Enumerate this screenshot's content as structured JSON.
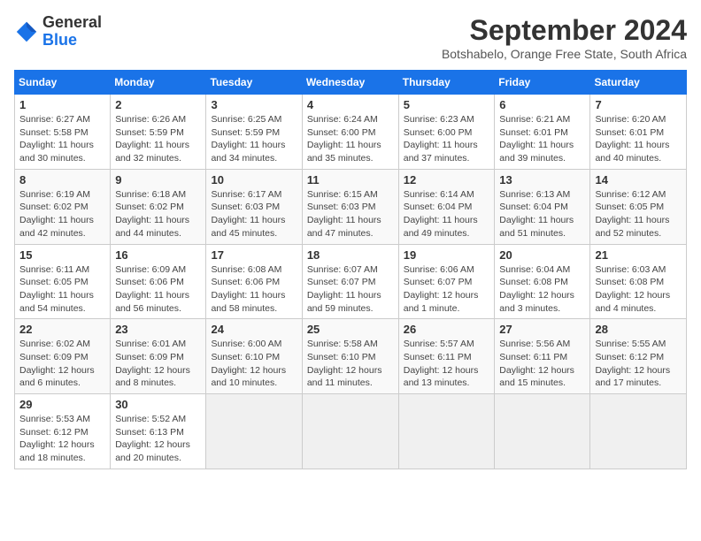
{
  "header": {
    "logo": {
      "general": "General",
      "blue": "Blue"
    },
    "title": "September 2024",
    "location": "Botshabelo, Orange Free State, South Africa"
  },
  "calendar": {
    "days_of_week": [
      "Sunday",
      "Monday",
      "Tuesday",
      "Wednesday",
      "Thursday",
      "Friday",
      "Saturday"
    ],
    "weeks": [
      [
        null,
        {
          "day": "2",
          "sunrise": "Sunrise: 6:26 AM",
          "sunset": "Sunset: 5:59 PM",
          "daylight": "Daylight: 11 hours and 32 minutes."
        },
        {
          "day": "3",
          "sunrise": "Sunrise: 6:25 AM",
          "sunset": "Sunset: 5:59 PM",
          "daylight": "Daylight: 11 hours and 34 minutes."
        },
        {
          "day": "4",
          "sunrise": "Sunrise: 6:24 AM",
          "sunset": "Sunset: 6:00 PM",
          "daylight": "Daylight: 11 hours and 35 minutes."
        },
        {
          "day": "5",
          "sunrise": "Sunrise: 6:23 AM",
          "sunset": "Sunset: 6:00 PM",
          "daylight": "Daylight: 11 hours and 37 minutes."
        },
        {
          "day": "6",
          "sunrise": "Sunrise: 6:21 AM",
          "sunset": "Sunset: 6:01 PM",
          "daylight": "Daylight: 11 hours and 39 minutes."
        },
        {
          "day": "7",
          "sunrise": "Sunrise: 6:20 AM",
          "sunset": "Sunset: 6:01 PM",
          "daylight": "Daylight: 11 hours and 40 minutes."
        }
      ],
      [
        {
          "day": "1",
          "sunrise": "Sunrise: 6:27 AM",
          "sunset": "Sunset: 5:58 PM",
          "daylight": "Daylight: 11 hours and 30 minutes."
        },
        null,
        null,
        null,
        null,
        null,
        null
      ],
      [
        {
          "day": "8",
          "sunrise": "Sunrise: 6:19 AM",
          "sunset": "Sunset: 6:02 PM",
          "daylight": "Daylight: 11 hours and 42 minutes."
        },
        {
          "day": "9",
          "sunrise": "Sunrise: 6:18 AM",
          "sunset": "Sunset: 6:02 PM",
          "daylight": "Daylight: 11 hours and 44 minutes."
        },
        {
          "day": "10",
          "sunrise": "Sunrise: 6:17 AM",
          "sunset": "Sunset: 6:03 PM",
          "daylight": "Daylight: 11 hours and 45 minutes."
        },
        {
          "day": "11",
          "sunrise": "Sunrise: 6:15 AM",
          "sunset": "Sunset: 6:03 PM",
          "daylight": "Daylight: 11 hours and 47 minutes."
        },
        {
          "day": "12",
          "sunrise": "Sunrise: 6:14 AM",
          "sunset": "Sunset: 6:04 PM",
          "daylight": "Daylight: 11 hours and 49 minutes."
        },
        {
          "day": "13",
          "sunrise": "Sunrise: 6:13 AM",
          "sunset": "Sunset: 6:04 PM",
          "daylight": "Daylight: 11 hours and 51 minutes."
        },
        {
          "day": "14",
          "sunrise": "Sunrise: 6:12 AM",
          "sunset": "Sunset: 6:05 PM",
          "daylight": "Daylight: 11 hours and 52 minutes."
        }
      ],
      [
        {
          "day": "15",
          "sunrise": "Sunrise: 6:11 AM",
          "sunset": "Sunset: 6:05 PM",
          "daylight": "Daylight: 11 hours and 54 minutes."
        },
        {
          "day": "16",
          "sunrise": "Sunrise: 6:09 AM",
          "sunset": "Sunset: 6:06 PM",
          "daylight": "Daylight: 11 hours and 56 minutes."
        },
        {
          "day": "17",
          "sunrise": "Sunrise: 6:08 AM",
          "sunset": "Sunset: 6:06 PM",
          "daylight": "Daylight: 11 hours and 58 minutes."
        },
        {
          "day": "18",
          "sunrise": "Sunrise: 6:07 AM",
          "sunset": "Sunset: 6:07 PM",
          "daylight": "Daylight: 11 hours and 59 minutes."
        },
        {
          "day": "19",
          "sunrise": "Sunrise: 6:06 AM",
          "sunset": "Sunset: 6:07 PM",
          "daylight": "Daylight: 12 hours and 1 minute."
        },
        {
          "day": "20",
          "sunrise": "Sunrise: 6:04 AM",
          "sunset": "Sunset: 6:08 PM",
          "daylight": "Daylight: 12 hours and 3 minutes."
        },
        {
          "day": "21",
          "sunrise": "Sunrise: 6:03 AM",
          "sunset": "Sunset: 6:08 PM",
          "daylight": "Daylight: 12 hours and 4 minutes."
        }
      ],
      [
        {
          "day": "22",
          "sunrise": "Sunrise: 6:02 AM",
          "sunset": "Sunset: 6:09 PM",
          "daylight": "Daylight: 12 hours and 6 minutes."
        },
        {
          "day": "23",
          "sunrise": "Sunrise: 6:01 AM",
          "sunset": "Sunset: 6:09 PM",
          "daylight": "Daylight: 12 hours and 8 minutes."
        },
        {
          "day": "24",
          "sunrise": "Sunrise: 6:00 AM",
          "sunset": "Sunset: 6:10 PM",
          "daylight": "Daylight: 12 hours and 10 minutes."
        },
        {
          "day": "25",
          "sunrise": "Sunrise: 5:58 AM",
          "sunset": "Sunset: 6:10 PM",
          "daylight": "Daylight: 12 hours and 11 minutes."
        },
        {
          "day": "26",
          "sunrise": "Sunrise: 5:57 AM",
          "sunset": "Sunset: 6:11 PM",
          "daylight": "Daylight: 12 hours and 13 minutes."
        },
        {
          "day": "27",
          "sunrise": "Sunrise: 5:56 AM",
          "sunset": "Sunset: 6:11 PM",
          "daylight": "Daylight: 12 hours and 15 minutes."
        },
        {
          "day": "28",
          "sunrise": "Sunrise: 5:55 AM",
          "sunset": "Sunset: 6:12 PM",
          "daylight": "Daylight: 12 hours and 17 minutes."
        }
      ],
      [
        {
          "day": "29",
          "sunrise": "Sunrise: 5:53 AM",
          "sunset": "Sunset: 6:12 PM",
          "daylight": "Daylight: 12 hours and 18 minutes."
        },
        {
          "day": "30",
          "sunrise": "Sunrise: 5:52 AM",
          "sunset": "Sunset: 6:13 PM",
          "daylight": "Daylight: 12 hours and 20 minutes."
        },
        null,
        null,
        null,
        null,
        null
      ]
    ]
  }
}
